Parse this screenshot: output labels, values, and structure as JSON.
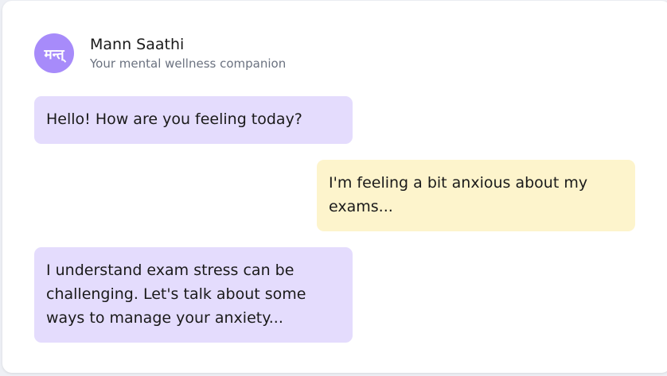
{
  "colors": {
    "avatar_bg": "#a78bfa",
    "bot_bubble": "#e4dcfd",
    "user_bubble": "#fdf4cc"
  },
  "header": {
    "avatar_text": "मन्त्",
    "title": "Mann Saathi",
    "subtitle": "Your mental wellness companion"
  },
  "messages": [
    {
      "sender": "bot",
      "text": "Hello! How are you feeling today?"
    },
    {
      "sender": "user",
      "text": "I'm feeling a bit anxious about my exams..."
    },
    {
      "sender": "bot",
      "text": "I understand exam stress can be challenging. Let's talk about some ways to manage your anxiety..."
    }
  ]
}
